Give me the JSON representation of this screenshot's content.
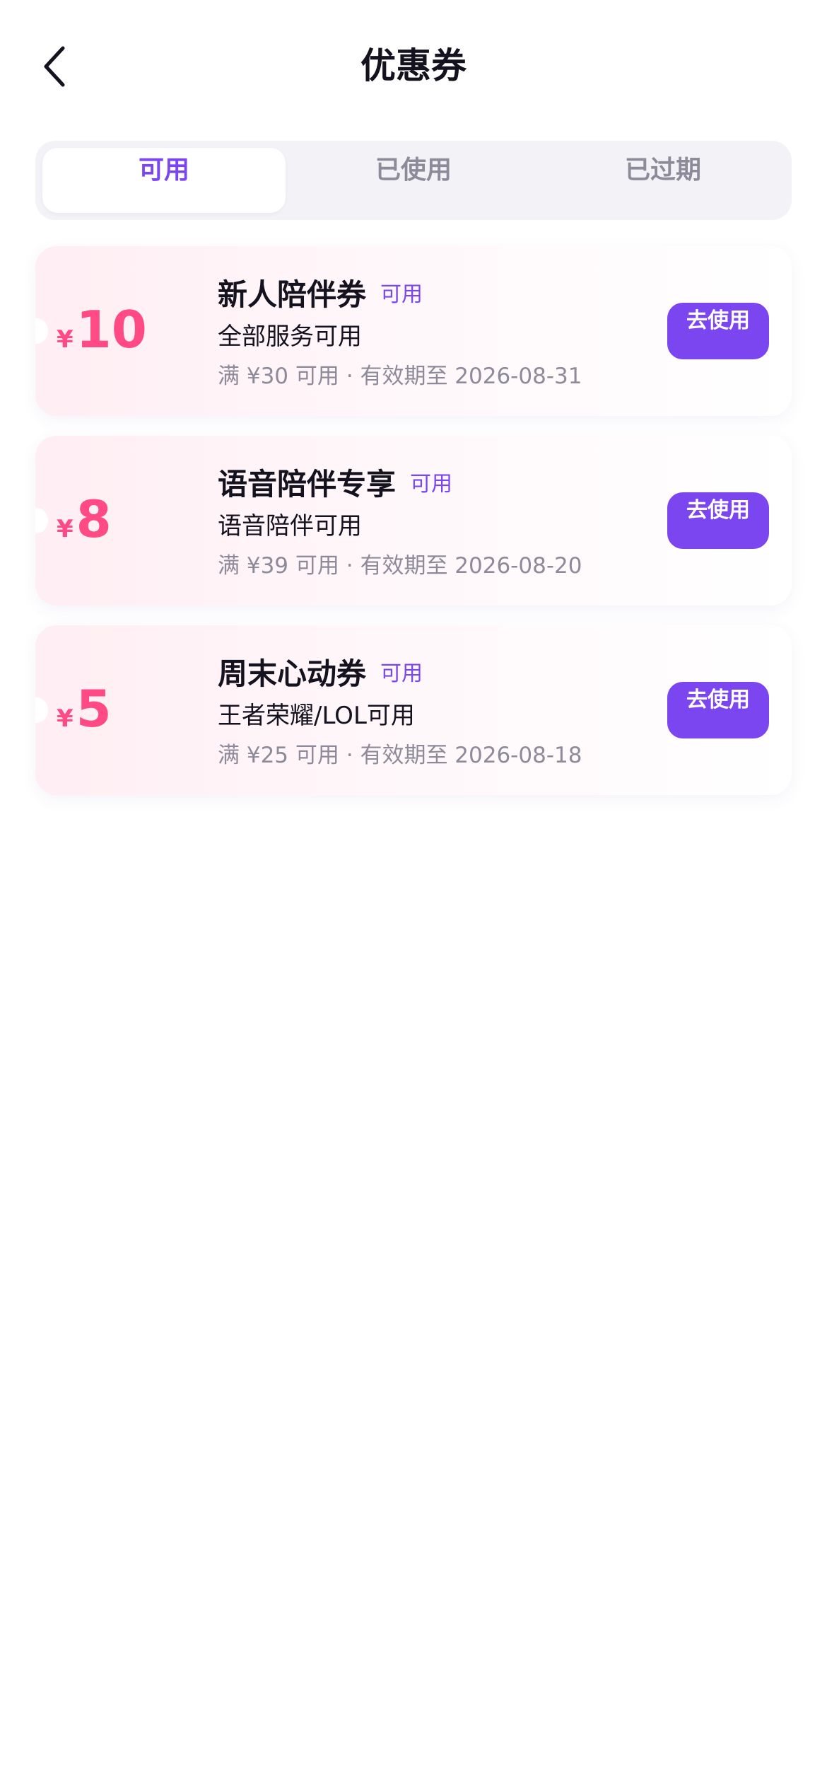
{
  "header": {
    "title": "优惠券",
    "back_icon": "chevron-left-icon"
  },
  "tabs": [
    {
      "label": "可用",
      "active": true
    },
    {
      "label": "已使用",
      "active": false
    },
    {
      "label": "已过期",
      "active": false
    }
  ],
  "coupons": [
    {
      "currency": "¥",
      "amount": "10",
      "title": "新人陪伴券",
      "status": "可用",
      "scope": "全部服务可用",
      "terms": "满 ¥30 可用 · 有效期至 2026-08-31",
      "button_label": "去使用"
    },
    {
      "currency": "¥",
      "amount": "8",
      "title": "语音陪伴专享",
      "status": "可用",
      "scope": "语音陪伴可用",
      "terms": "满 ¥39 可用 · 有效期至 2026-08-20",
      "button_label": "去使用"
    },
    {
      "currency": "¥",
      "amount": "5",
      "title": "周末心动券",
      "status": "可用",
      "scope": "王者荣耀/LOL可用",
      "terms": "满 ¥25 可用 · 有效期至 2026-08-18",
      "button_label": "去使用"
    }
  ],
  "colors": {
    "accent": "#7b45f0",
    "amount": "#ff4a85",
    "muted_text": "#8d8a99",
    "primary_text": "#14121f"
  }
}
